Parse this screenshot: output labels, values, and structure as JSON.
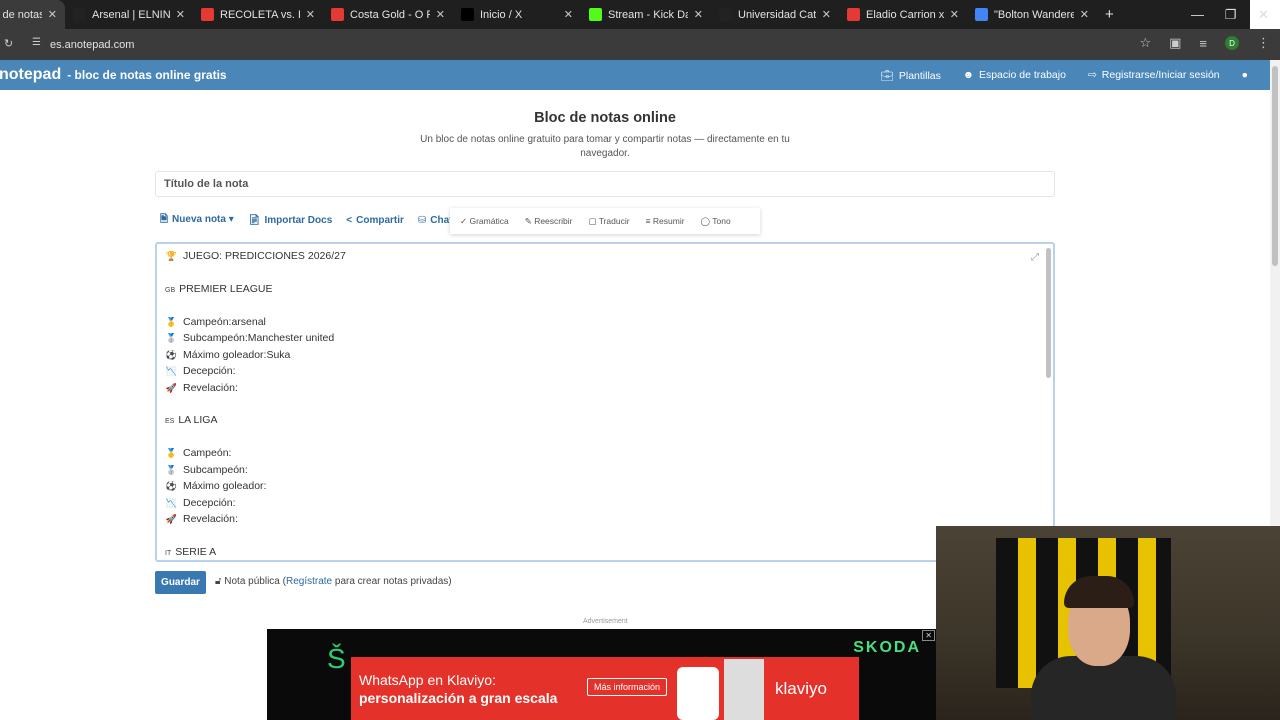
{
  "browser": {
    "tabs": [
      {
        "title": "Bloc de notas en línea",
        "color": "#444"
      },
      {
        "title": "Arsenal | ELNINE",
        "color": "#222"
      },
      {
        "title": "RECOLETA vs. BOCA J",
        "color": "#e53935"
      },
      {
        "title": "Costa Gold - O Pa",
        "color": "#e53935"
      },
      {
        "title": "Inicio / X",
        "color": "#000"
      },
      {
        "title": "Stream - Kick Dashb",
        "color": "#53fc18"
      },
      {
        "title": "Universidad Católica",
        "color": "#222"
      },
      {
        "title": "Eladio Carrion x Nata",
        "color": "#e53935"
      },
      {
        "title": "\"Bolton Wanderers -",
        "color": "#4285f4"
      }
    ],
    "url": "es.anotepad.com",
    "profile_initial": "D"
  },
  "site": {
    "logo": "notepad",
    "tagline": "- bloc de notas online gratis",
    "nav": [
      "Plantillas",
      "Espacio de trabajo",
      "Registrarse/Iniciar sesión"
    ]
  },
  "page": {
    "title": "Bloc de notas online",
    "subtitle": "Un bloc de notas online gratuito para tomar y compartir notas — directamente en tu navegador.",
    "note_title_placeholder": "Título de la nota"
  },
  "toolbar": {
    "items": [
      "Nueva nota",
      "Importar Docs",
      "Compartir",
      "Chat"
    ],
    "ai_tools": [
      "Gramática",
      "Reescribir",
      "Traducir",
      "Resumir",
      "Tono"
    ]
  },
  "editor": {
    "lines": [
      {
        "icon": "trophy-icon",
        "emo": "🏆",
        "text": "JUEGO: PREDICCIONES 2026/27"
      },
      {
        "flag": "GB",
        "text": "PREMIER LEAGUE"
      },
      {
        "icon": "gold-medal-icon",
        "emo": "🥇",
        "text": "Campeón:arsenal"
      },
      {
        "icon": "silver-medal-icon",
        "emo": "🥈",
        "text": "Subcampeón:Manchester united"
      },
      {
        "icon": "soccer-ball-icon",
        "emo": "⚽",
        "text": "Máximo goleador:Suka"
      },
      {
        "icon": "down-chart-icon",
        "emo": "📉",
        "text": "Decepción:"
      },
      {
        "icon": "rocket-icon",
        "emo": "🚀",
        "text": "Revelación:"
      },
      {
        "flag": "ES",
        "text": "LA LIGA"
      },
      {
        "icon": "gold-medal-icon",
        "emo": "🥇",
        "text": "Campeón:"
      },
      {
        "icon": "silver-medal-icon",
        "emo": "🥈",
        "text": "Subcampeón:"
      },
      {
        "icon": "soccer-ball-icon",
        "emo": "⚽",
        "text": "Máximo goleador:"
      },
      {
        "icon": "down-chart-icon",
        "emo": "📉",
        "text": "Decepción:"
      },
      {
        "icon": "rocket-icon",
        "emo": "🚀",
        "text": "Revelación:"
      },
      {
        "flag": "IT",
        "text": "SERIE A"
      }
    ]
  },
  "footer": {
    "save_label": "Guardar",
    "public_note": "Nota pública (",
    "register_link": "Regístrate",
    "public_note_end": " para crear notas privadas)",
    "ad_label": "Advertisement"
  },
  "ad": {
    "brand": "SKODA",
    "headline_1": "WhatsApp en Klaviyo:",
    "headline_2": "personalización a gran escala",
    "cta": "Más información",
    "advertiser": "klaviyo"
  }
}
